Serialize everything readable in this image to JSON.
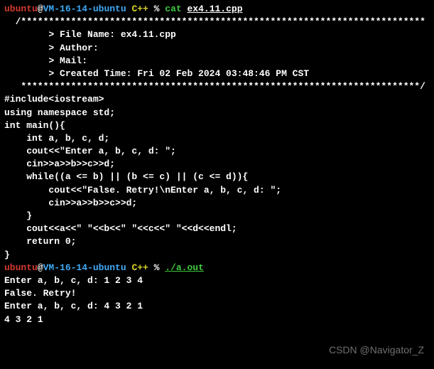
{
  "prompt1": {
    "user": "ubuntu",
    "at": "@",
    "host": "VM-16-14-ubuntu",
    "path": " C++",
    "pct": " % ",
    "cmd": "cat",
    "arg": "ex4.11.cpp"
  },
  "file": {
    "topborder": "  /*************************************************************************",
    "fname": "        > File Name: ex4.11.cpp",
    "author": "        > Author:",
    "mail": "        > Mail:",
    "created": "        > Created Time: Fri 02 Feb 2024 03:48:46 PM CST",
    "botborder": "   ************************************************************************/",
    "blank1": "",
    "inc": "#include<iostream>",
    "ns": "using namespace std;",
    "blank2": "",
    "main": "int main(){",
    "decl": "    int a, b, c, d;",
    "cout1": "    cout<<\"Enter a, b, c, d: \";",
    "cin1": "    cin>>a>>b>>c>>d;",
    "while": "    while((a <= b) || (b <= c) || (c <= d)){",
    "cout2": "        cout<<\"False. Retry!\\nEnter a, b, c, d: \";",
    "cin2": "        cin>>a>>b>>c>>d;",
    "closew": "    }",
    "cout3": "    cout<<a<<\" \"<<b<<\" \"<<c<<\" \"<<d<<endl;",
    "ret": "    return 0;",
    "closem": "}"
  },
  "prompt2": {
    "user": "ubuntu",
    "at": "@",
    "host": "VM-16-14-ubuntu",
    "path": " C++",
    "pct": " % ",
    "cmd": "./a.out"
  },
  "run": {
    "l1": "Enter a, b, c, d: 1 2 3 4",
    "l2": "False. Retry!",
    "l3": "Enter a, b, c, d: 4 3 2 1",
    "l4": "4 3 2 1"
  },
  "watermark": "CSDN @Navigator_Z"
}
